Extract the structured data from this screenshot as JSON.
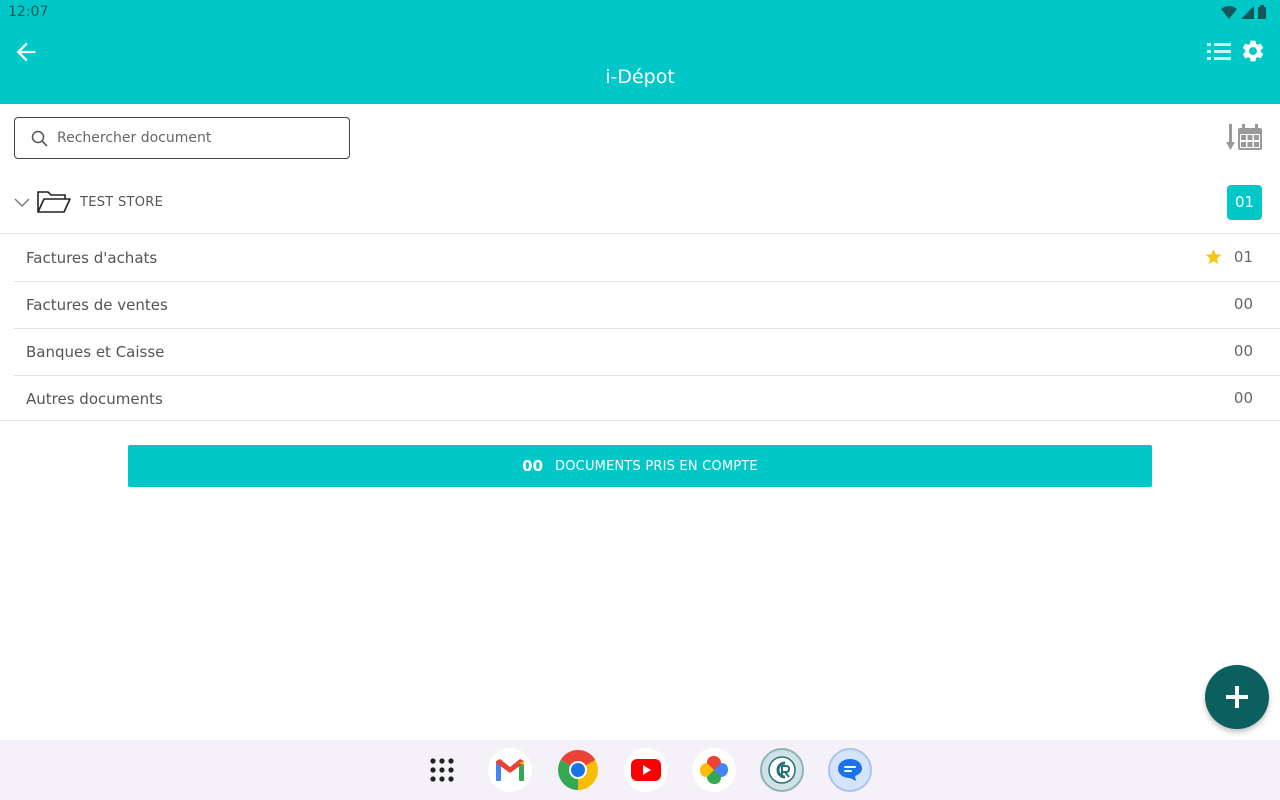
{
  "status": {
    "time": "12:07"
  },
  "app": {
    "title": "i-Dépot"
  },
  "search": {
    "placeholder": "Rechercher document"
  },
  "folder": {
    "name": "TEST STORE",
    "count": "01"
  },
  "categories": [
    {
      "label": "Factures d'achats",
      "count": "01",
      "starred": true
    },
    {
      "label": "Factures de ventes",
      "count": "00",
      "starred": false
    },
    {
      "label": "Banques et Caisse",
      "count": "00",
      "starred": false
    },
    {
      "label": "Autres documents",
      "count": "00",
      "starred": false
    }
  ],
  "banner": {
    "count": "00",
    "label": "DOCUMENTS PRIS EN COMPTE"
  },
  "colors": {
    "accent": "#00C8C8",
    "fab": "#0b5f5f",
    "star": "#F5C518"
  },
  "dock_apps": [
    "app-drawer-icon",
    "gmail-icon",
    "chrome-icon",
    "youtube-icon",
    "photos-icon",
    "cr-app-icon",
    "messages-icon"
  ]
}
